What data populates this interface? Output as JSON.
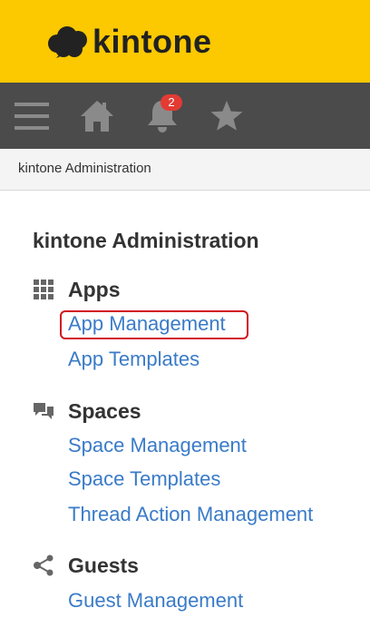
{
  "header": {
    "brand": "kintone"
  },
  "nav": {
    "menu_icon": "hamburger-menu-icon",
    "home_icon": "home-icon",
    "notifications_icon": "bell-icon",
    "notifications_count": "2",
    "favorites_icon": "star-icon"
  },
  "breadcrumb": {
    "current": "kintone Administration"
  },
  "main": {
    "title": "kintone Administration",
    "sections": [
      {
        "icon": "grid-icon",
        "title": "Apps",
        "links": [
          "App Management",
          "App Templates"
        ]
      },
      {
        "icon": "speech-bubbles-icon",
        "title": "Spaces",
        "links": [
          "Space Management",
          "Space Templates",
          "Thread Action Management"
        ]
      },
      {
        "icon": "share-nodes-icon",
        "title": "Guests",
        "links": [
          "Guest Management"
        ]
      }
    ]
  },
  "colors": {
    "header_bg": "#fcc800",
    "nav_bg": "#4b4b4b",
    "link": "#3a7bc8",
    "highlight": "#d2141e",
    "badge": "#e23b34"
  }
}
